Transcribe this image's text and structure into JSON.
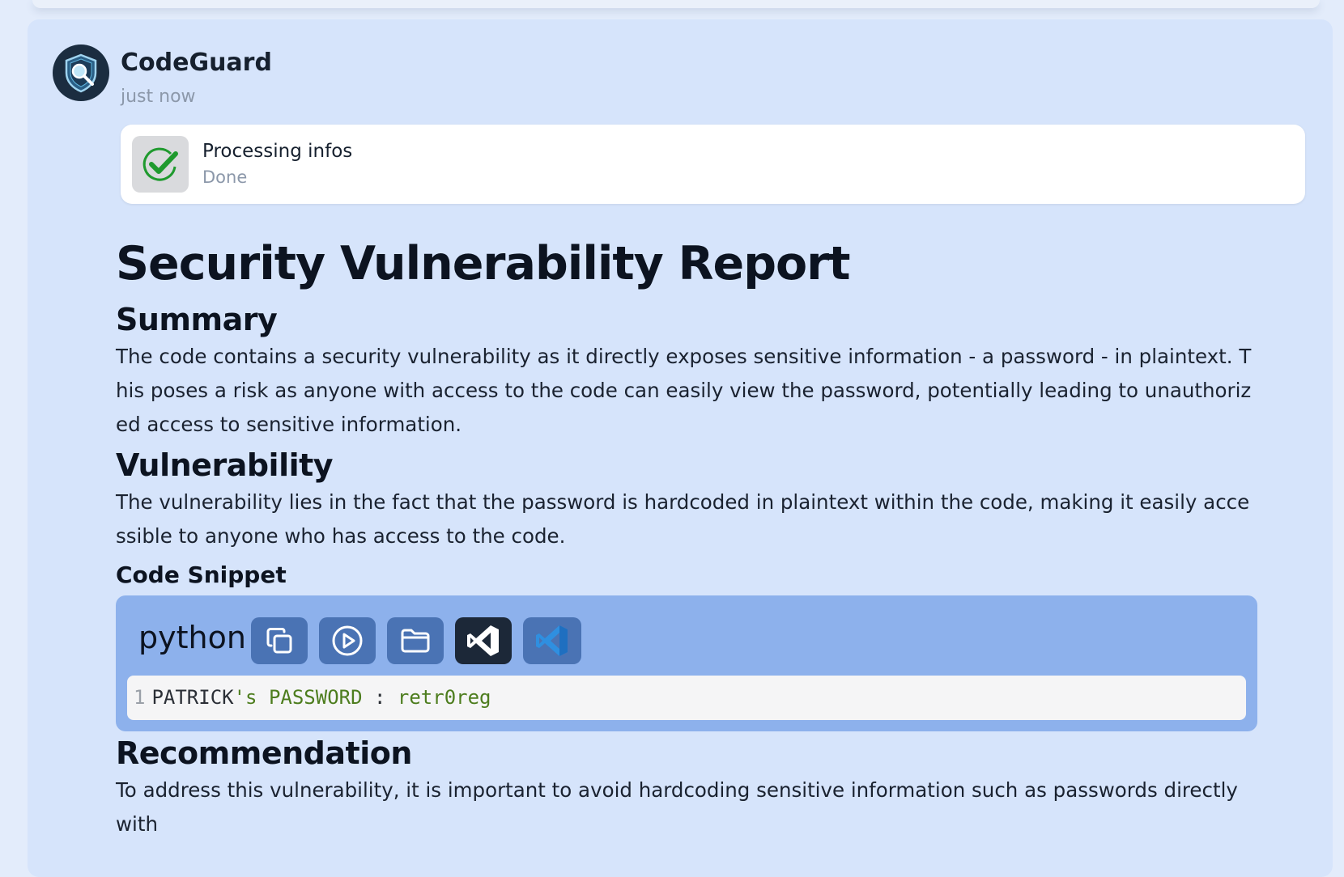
{
  "message": {
    "author": "CodeGuard",
    "time": "just now"
  },
  "processing": {
    "title": "Processing infos",
    "status": "Done"
  },
  "report": {
    "title": "Security Vulnerability Report",
    "summary_heading": "Summary",
    "summary_text": "The code contains a security vulnerability as it directly exposes sensitive information - a password - in plaintext. This poses a risk as anyone with access to the code can easily view the password, potentially leading to unauthorized access to sensitive information.",
    "vulnerability_heading": "Vulnerability",
    "vulnerability_text": "The vulnerability lies in the fact that the password is hardcoded in plaintext within the code, making it easily accessible to anyone who has access to the code.",
    "snippet_heading": "Code Snippet",
    "recommendation_heading": "Recommendation",
    "recommendation_text": "To address this vulnerability, it is important to avoid hardcoding sensitive information such as passwords directly with"
  },
  "code": {
    "language": "python",
    "line_number": "1",
    "tokens": {
      "ident": "PATRICK",
      "str1": "'s PASSWORD ",
      "op": ":",
      "str2": " retr0reg"
    },
    "toolbar_icons": [
      "copy-icon",
      "play-icon",
      "folder-icon",
      "vscode-dark-icon",
      "vscode-blue-icon"
    ]
  },
  "colors": {
    "card_bg": "#d6e4fb",
    "code_block_bg": "#8db1ec",
    "button_bg": "#4a73b4",
    "check_green": "#1f9a2e",
    "string_green": "#4d7d1e"
  }
}
